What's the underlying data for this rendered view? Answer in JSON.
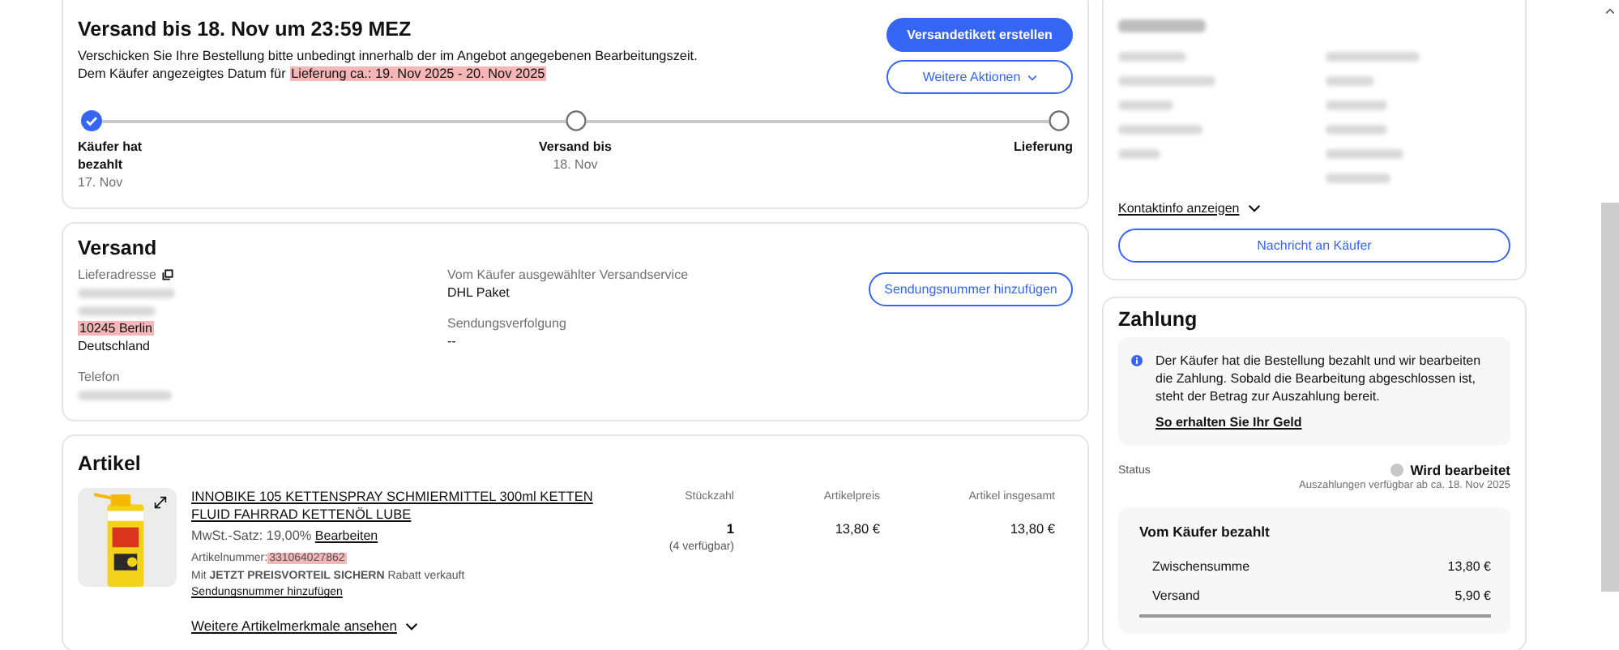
{
  "shipping_deadline": {
    "title": "Versand bis 18. Nov um 23:59 MEZ",
    "instruction": "Verschicken Sie Ihre Bestellung bitte unbedingt innerhalb der im Angebot angegebenen Bearbeitungszeit.",
    "delivery_prefix": "Dem Käufer angezeigtes Datum für ",
    "delivery_highlight": "Lieferung ca.: 19. Nov 2025 - 20. Nov 2025",
    "primary_button": "Versandetikett erstellen",
    "secondary_button": "Weitere Aktionen",
    "steps": [
      {
        "label": "Käufer hat bezahlt",
        "date": "17. Nov",
        "done": true
      },
      {
        "label": "Versand bis",
        "date": "18. Nov",
        "done": false
      },
      {
        "label": "Lieferung",
        "done": false
      }
    ]
  },
  "shipping": {
    "title": "Versand",
    "address_label": "Lieferadresse",
    "address_city": "10245 Berlin",
    "address_country": "Deutschland",
    "phone_label": "Telefon",
    "service_label": "Vom Käufer ausgewählter Versandservice",
    "service_value": "DHL Paket",
    "tracking_label": "Sendungsverfolgung",
    "tracking_value": "--",
    "tracking_button": "Sendungsnummer hinzufügen"
  },
  "items": {
    "title": "Artikel",
    "columns": [
      "Stückzahl",
      "Artikelpreis",
      "Artikel insgesamt"
    ],
    "item": {
      "title": "INNOBIKE 105 KETTENSPRAY SCHMIERMITTEL 300ml KETTEN FLUID FAHRRAD KETTENÖL LUBE",
      "vat": "MwSt.-Satz: 19,00%",
      "vat_edit": "Bearbeiten",
      "number_label": "Artikelnummer:",
      "number": "331064027862",
      "promo": "Mit **JETZT PREISVORTEIL SICHERN** Rabatt verkauft",
      "add_tracking": "Sendungsnummer hinzufügen",
      "quantity": "1",
      "available": "(4 verfügbar)",
      "price": "13,80 €",
      "total": "13,80 €"
    },
    "more": "Weitere Artikelmerkmale ansehen"
  },
  "order": {
    "contact_link": "Kontaktinfo anzeigen",
    "message_button": "Nachricht an Käufer"
  },
  "payment": {
    "title": "Zahlung",
    "info": "Der Käufer hat die Bestellung bezahlt und wir bearbeiten die Zahlung. Sobald die Bearbeitung abgeschlossen ist, steht der Betrag zur Auszahlung bereit.",
    "info_link": "So erhalten Sie Ihr Geld",
    "status_label": "Status",
    "status_value": "Wird bearbeitet",
    "payout_note": "Auszahlungen verfügbar ab ca. 18. Nov 2025",
    "paid_title": "Vom Käufer bezahlt",
    "lines": [
      {
        "label": "Zwischensumme",
        "value": "13,80 €"
      },
      {
        "label": "Versand",
        "value": "5,90 €"
      }
    ]
  }
}
